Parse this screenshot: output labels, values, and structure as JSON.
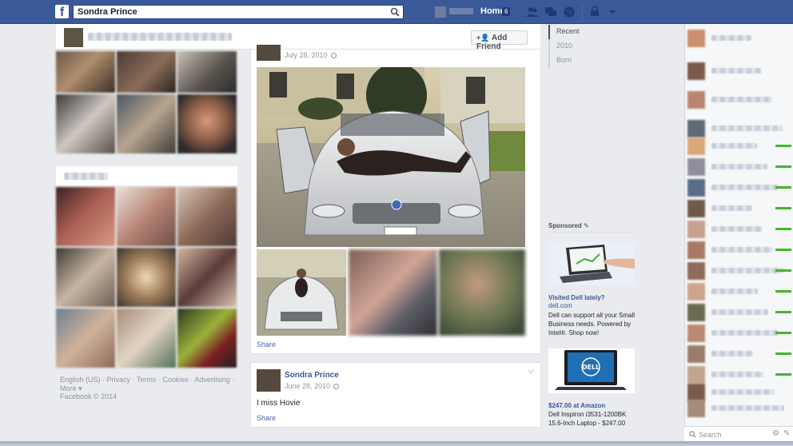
{
  "topbar": {
    "search_value": "Sondra Prince",
    "home_label": "Home",
    "home_count": "6"
  },
  "profile_strip": {
    "add_friend_label": "Add Friend"
  },
  "post1": {
    "timestamp": "July 28, 2010",
    "share_label": "Share"
  },
  "post2": {
    "poster_name": "Sondra Prince",
    "timestamp": "June 28, 2010",
    "text": "I miss Hovie",
    "share_label": "Share"
  },
  "timeline_nav": {
    "items": [
      "Recent",
      "2010",
      "Born"
    ]
  },
  "sponsored": {
    "header": "Sponsored",
    "ads": [
      {
        "title": "Visited Dell lately?",
        "domain": "dell.com",
        "body": "Dell can support all your Small Business needs. Powered by Intel®. Shop now!"
      },
      {
        "title": "$247.00 at Amazon",
        "body_line1": "Dell Inspiron i3531-1200BK",
        "body_line2": "15.6-Inch Laptop - $247.00"
      }
    ],
    "ad_brand": "DELL"
  },
  "footer": {
    "links": "English (US) · Privacy · Terms · Cookies · Advertising ·",
    "more": "More",
    "copyright": "Facebook © 2014"
  },
  "chat": {
    "search_placeholder": "Search"
  },
  "colors": {
    "brand_blue": "#3b5998",
    "link_blue": "#365899",
    "online_green": "#42b72a"
  }
}
